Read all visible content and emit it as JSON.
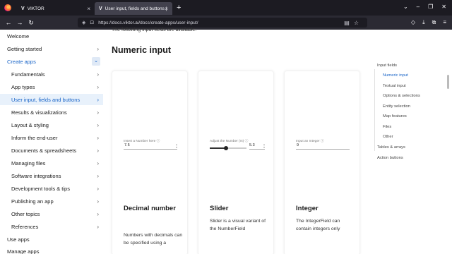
{
  "browser": {
    "tabs": [
      {
        "label": "VIKTOR",
        "close": "×"
      },
      {
        "label": "User input, fields and buttons |",
        "close": "×"
      }
    ],
    "new_tab": "+",
    "url": "https://docs.viktor.ai/docs/create-apps/user-input/"
  },
  "sidebar": {
    "items": [
      {
        "label": "Welcome",
        "chevron": ""
      },
      {
        "label": "Getting started",
        "chevron": "›"
      },
      {
        "label": "Create apps",
        "chevron": "⌄"
      },
      {
        "label": "Fundamentals",
        "chevron": "›"
      },
      {
        "label": "App types",
        "chevron": "›"
      },
      {
        "label": "User input, fields and buttons",
        "chevron": "›"
      },
      {
        "label": "Results & visualizations",
        "chevron": "›"
      },
      {
        "label": "Layout & styling",
        "chevron": "›"
      },
      {
        "label": "Inform the end-user",
        "chevron": "›"
      },
      {
        "label": "Documents & spreadsheets",
        "chevron": "›"
      },
      {
        "label": "Managing files",
        "chevron": "›"
      },
      {
        "label": "Software integrations",
        "chevron": "›"
      },
      {
        "label": "Development tools & tips",
        "chevron": "›"
      },
      {
        "label": "Publishing an app",
        "chevron": "›"
      },
      {
        "label": "Other topics",
        "chevron": "›"
      },
      {
        "label": "References",
        "chevron": "›"
      },
      {
        "label": "Use apps",
        "chevron": ""
      },
      {
        "label": "Manage apps",
        "chevron": ""
      }
    ]
  },
  "main": {
    "cut_text": "The following input fields are available:",
    "heading": "Numeric input",
    "cards": [
      {
        "field_label": "Insert a Number here ⓘ",
        "field_value": "7.5",
        "title": "Decimal number",
        "desc": "Numbers with decimals can be specified using a"
      },
      {
        "field_label": "Adjust the Number (m) ⓘ",
        "field_value": "5.3",
        "slider_level": 0.45,
        "title": "Slider",
        "desc": "Slider is a visual variant of the NumberField"
      },
      {
        "field_label": "Input an Integer ⓘ",
        "field_value": "9",
        "title": "Integer",
        "desc": "The IntegerField can contain integers only"
      }
    ]
  },
  "toc": {
    "items": [
      {
        "label": "Input fields"
      },
      {
        "label": "Numeric input"
      },
      {
        "label": "Textual input"
      },
      {
        "label": "Options & selections"
      },
      {
        "label": "Entity selection"
      },
      {
        "label": "Map features"
      },
      {
        "label": "Files"
      },
      {
        "label": "Other"
      },
      {
        "label": "Tables & arrays"
      },
      {
        "label": "Action buttons"
      }
    ]
  },
  "colors": {
    "accent": "#1763c7",
    "active_bg": "#e8f1fb"
  }
}
